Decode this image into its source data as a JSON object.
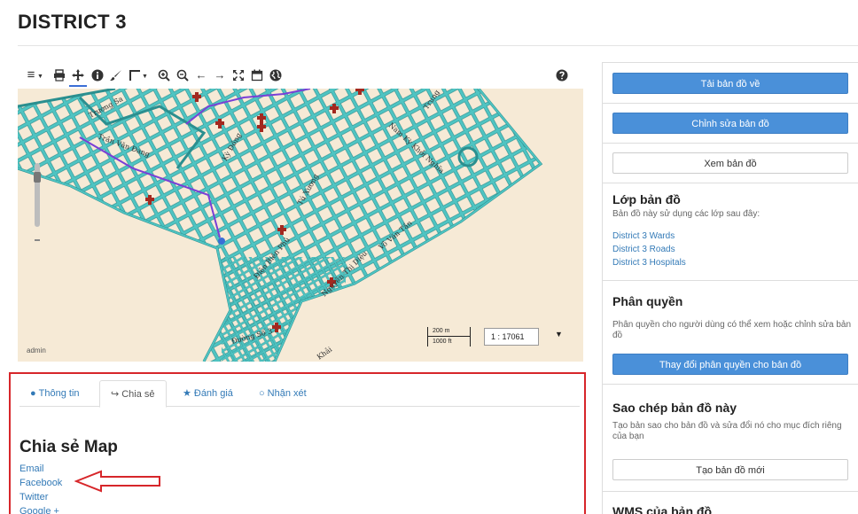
{
  "page": {
    "title": "DISTRICT 3"
  },
  "toolbar": {
    "tools": [
      {
        "name": "menu-icon",
        "glyph": "≡"
      },
      {
        "name": "print-icon",
        "glyph": "print"
      },
      {
        "name": "pan-icon",
        "glyph": "pan"
      },
      {
        "name": "info-icon",
        "glyph": "info"
      },
      {
        "name": "draw-icon",
        "glyph": "brush"
      },
      {
        "name": "measure-icon",
        "glyph": "measure"
      },
      {
        "name": "zoom-in-icon",
        "glyph": "zoomin"
      },
      {
        "name": "zoom-out-icon",
        "glyph": "zoomout"
      },
      {
        "name": "back-icon",
        "glyph": "←"
      },
      {
        "name": "forward-icon",
        "glyph": "→"
      },
      {
        "name": "fullscreen-icon",
        "glyph": "⤧"
      },
      {
        "name": "bookmark-icon",
        "glyph": "bookmark"
      },
      {
        "name": "globe-icon",
        "glyph": "globe"
      },
      {
        "name": "help-icon",
        "glyph": "help"
      }
    ]
  },
  "map": {
    "credit": "admin",
    "scale_top": "200 m",
    "scale_bottom": "1000 ft",
    "scale_value": "1 : 17061",
    "street_labels": [
      "Trương Sa",
      "Trần Văn Đang",
      "Kỳ Đồng",
      "Tú Xương",
      "Nam Kỳ Khởi Nghĩa",
      "Điện Biên Phủ",
      "Võ Văn Tần",
      "Nguyễn Thị Diệu",
      "Đường Số 3",
      "Trung",
      "Khải"
    ],
    "colors": {
      "background": "#f6ead6",
      "road": "#4fc4c2",
      "road_outline": "#2b8f8f",
      "canal": "#7a3fd6",
      "hospital": "#a3281f"
    }
  },
  "bottom_panel": {
    "tabs": [
      {
        "label": "Thông tin",
        "icon": "info-circle-icon"
      },
      {
        "label": "Chia sẻ",
        "icon": "share-icon"
      },
      {
        "label": "Đánh giá",
        "icon": "star-icon"
      },
      {
        "label": "Nhận xét",
        "icon": "comment-icon"
      }
    ],
    "active_tab": "Chia sẻ",
    "share_title": "Chia sẻ Map",
    "share_links": [
      "Email",
      "Facebook",
      "Twitter",
      "Google +"
    ],
    "highlight_color": "#d7262a"
  },
  "sidebar": {
    "download_button": "Tải bản đồ về",
    "edit_button": "Chỉnh sửa bản đồ",
    "view_button": "Xem bản đồ",
    "layers": {
      "heading": "Lớp bản đồ",
      "description": "Bản đồ này sử dụng các lớp sau đây:",
      "items": [
        "District 3 Wards",
        "District 3 Roads",
        "District 3 Hospitals"
      ]
    },
    "permissions": {
      "heading": "Phân quyền",
      "description": "Phân quyền cho người dùng có thể xem hoặc chỉnh sửa bản đồ",
      "button": "Thay đổi phân quyền cho bản đồ"
    },
    "copy": {
      "heading": "Sao chép bản đồ này",
      "description": "Tạo bản sao cho bản đồ và sửa đổi nó cho mục đích riêng của bạn",
      "button": "Tạo bản đồ mới"
    },
    "wms": {
      "heading": "WMS của bản đồ"
    },
    "primary_color": "#4a90d9"
  }
}
